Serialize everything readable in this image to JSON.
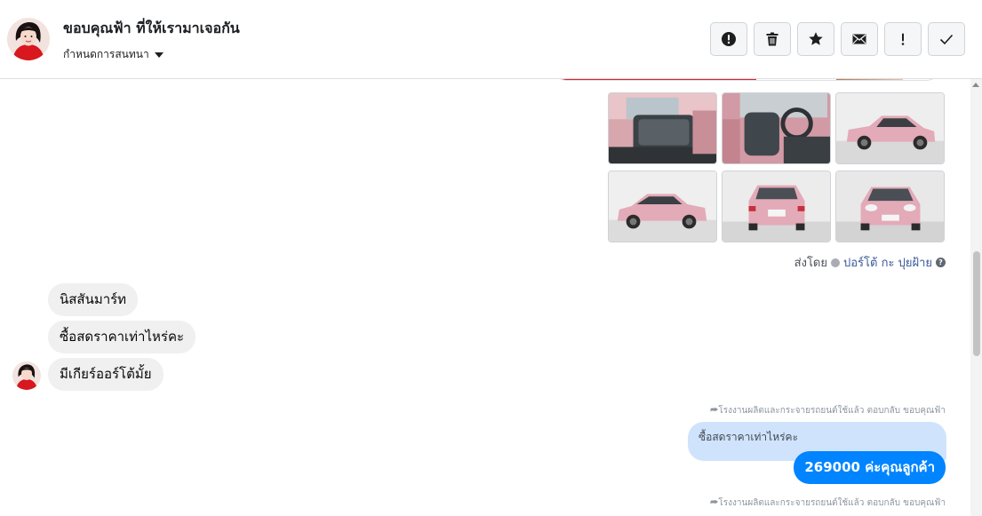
{
  "header": {
    "contact_name": "ขอบคุณฟ้า ที่ให้เรามาเจอกัน",
    "assign_label": "กำหนดการสนทนา",
    "actions": [
      {
        "name": "report-button",
        "icon": "alert-circle-icon"
      },
      {
        "name": "delete-button",
        "icon": "trash-icon"
      },
      {
        "name": "star-button",
        "icon": "star-icon"
      },
      {
        "name": "mark-unread-button",
        "icon": "envelope-icon"
      },
      {
        "name": "important-button",
        "icon": "exclamation-icon"
      },
      {
        "name": "mark-done-button",
        "icon": "check-icon"
      }
    ]
  },
  "thread": {
    "photos": [
      {
        "label": "car-interior-rear-seat"
      },
      {
        "label": "car-interior-driver-seat"
      },
      {
        "label": "car-side-view-right"
      },
      {
        "label": "car-side-view-left"
      },
      {
        "label": "car-rear-view"
      },
      {
        "label": "car-front-view"
      }
    ],
    "sent_by": {
      "prefix": "ส่งโดย",
      "author": "ปอร์โต้ กะ ปุยฝ้าย"
    },
    "incoming_messages": [
      "นิสสันมาร์ท",
      "ซื้อสดราคาเท่าไหร่คะ",
      "มีเกียร์ออร์โต้มั้ย"
    ],
    "reply_label_1": "โรงงานผลิตและกระจายรถยนต์ใช้แล้ว ตอบกลับ ขอบคุณฟ้า",
    "quoted_text": "ซื้อสดราคาเท่าไหร่คะ",
    "outgoing_message": "269000 ค่ะคุณลูกค้า",
    "reply_label_2": "โรงงานผลิตและกระจายรถยนต์ใช้แล้ว ตอบกลับ ขอบคุณฟ้า"
  },
  "colors": {
    "outgoing_bubble": "#0084ff",
    "incoming_bubble": "#f1f0f0",
    "quote_bubble": "#cfe3fd",
    "car_pink": "#e3aab8"
  }
}
